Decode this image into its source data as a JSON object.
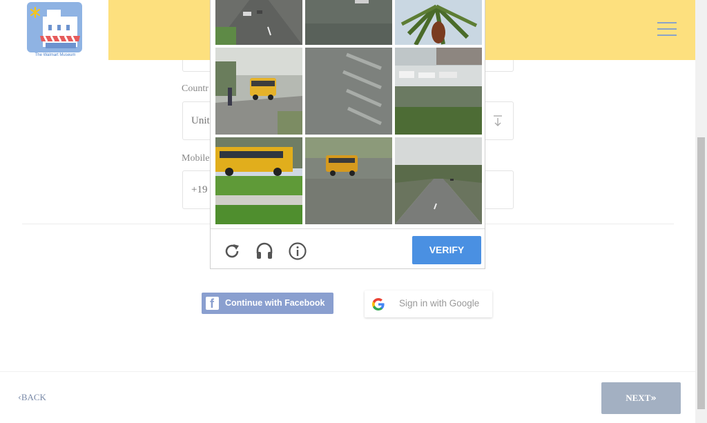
{
  "header": {
    "logo_text": "The Walmart Museum"
  },
  "form": {
    "country_label": "Countr",
    "country_value": "Unit",
    "mobile_label": "Mobile",
    "mobile_value": "+19"
  },
  "social": {
    "facebook_label": "Continue with Facebook",
    "google_label": "Sign in with Google"
  },
  "captcha": {
    "verify_label": "VERIFY",
    "tiles": [
      "road-top",
      "noise-road-top",
      "palm-tree",
      "school-bus-sidewalk",
      "noise-crosswalk",
      "marina",
      "school-bus-grass",
      "school-bus-noise",
      "highway"
    ]
  },
  "nav": {
    "back_label": "BACK",
    "next_label": "NEXT"
  },
  "colors": {
    "header_bg": "#fde07e",
    "verify_bg": "#4a90e2",
    "facebook_bg": "#8a9fcf",
    "next_bg": "#a3b0c2"
  }
}
